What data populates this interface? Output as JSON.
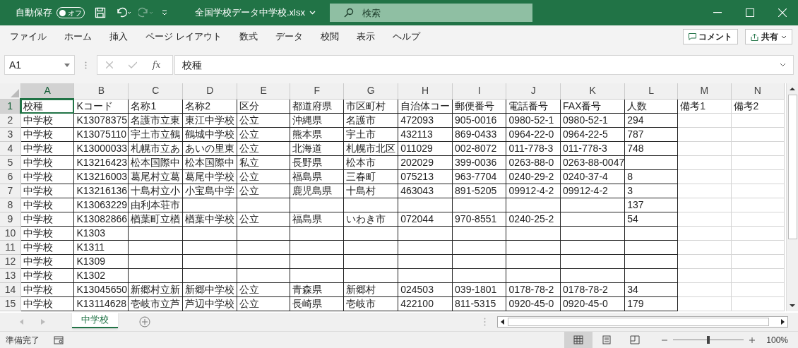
{
  "title_bar": {
    "autosave_label": "自動保存",
    "autosave_toggle": {
      "label": "オフ",
      "on": false
    },
    "file_name": "全国学校データ中学校.xlsx",
    "search_placeholder": "検索"
  },
  "ribbon_tabs": [
    "ファイル",
    "ホーム",
    "挿入",
    "ページ レイアウト",
    "数式",
    "データ",
    "校閲",
    "表示",
    "ヘルプ"
  ],
  "comment_button": "コメント",
  "share_button": "共有",
  "formula_bar": {
    "name_box": "A1",
    "fx": "fx",
    "formula": "校種"
  },
  "sheet": {
    "columns": [
      {
        "label": "A",
        "selected": true
      },
      {
        "label": "B",
        "selected": false
      },
      {
        "label": "C",
        "selected": false
      },
      {
        "label": "D",
        "selected": false
      },
      {
        "label": "E",
        "selected": false
      },
      {
        "label": "F",
        "selected": false
      },
      {
        "label": "G",
        "selected": false
      },
      {
        "label": "H",
        "selected": false
      },
      {
        "label": "I",
        "selected": false
      },
      {
        "label": "J",
        "selected": false
      },
      {
        "label": "K",
        "selected": false
      },
      {
        "label": "L",
        "selected": false
      },
      {
        "label": "M",
        "selected": false
      },
      {
        "label": "N",
        "selected": false
      }
    ],
    "rows": [
      {
        "number": "1",
        "selected": true,
        "cells": [
          "校種",
          "Kコード",
          "名称1",
          "名称2",
          "区分",
          "都道府県",
          "市区町村",
          "自治体コー",
          "郵便番号",
          "電話番号",
          "FAX番号",
          "人数",
          "備考1",
          "備考2"
        ]
      },
      {
        "number": "2",
        "selected": false,
        "cells": [
          "中学校",
          "K13078375",
          "名護市立東",
          "東江中学校",
          "公立",
          "沖縄県",
          "名護市",
          "472093",
          "905-0016",
          "0980-52-1",
          "0980-52-1",
          "294",
          null,
          null
        ]
      },
      {
        "number": "3",
        "selected": false,
        "cells": [
          "中学校",
          "K13075110",
          "宇土市立鶴",
          "鶴城中学校",
          "公立",
          "熊本県",
          "宇土市",
          "432113",
          "869-0433",
          "0964-22-0",
          "0964-22-5",
          "787",
          null,
          null
        ]
      },
      {
        "number": "4",
        "selected": false,
        "cells": [
          "中学校",
          "K13000033",
          "札幌市立あ",
          "あいの里東",
          "公立",
          "北海道",
          "札幌市北区",
          "011029",
          "002-8072",
          "011-778-3",
          "011-778-3",
          "748",
          null,
          null
        ]
      },
      {
        "number": "5",
        "selected": false,
        "cells": [
          "中学校",
          "K13216423",
          "松本国際中",
          "松本国際中",
          "私立",
          "長野県",
          "松本市",
          "202029",
          "399-0036",
          "0263-88-0",
          "0263-88-0047",
          null,
          null,
          null
        ]
      },
      {
        "number": "6",
        "selected": false,
        "cells": [
          "中学校",
          "K13216003",
          "葛尾村立葛",
          "葛尾中学校",
          "公立",
          "福島県",
          "三春町",
          "075213",
          "963-7704",
          "0240-29-2",
          "0240-37-4",
          "8",
          null,
          null
        ]
      },
      {
        "number": "7",
        "selected": false,
        "cells": [
          "中学校",
          "K13216136",
          "十島村立小",
          "小宝島中学",
          "公立",
          "鹿児島県",
          "十島村",
          "463043",
          "891-5205",
          "09912-4-2",
          "09912-4-2",
          "3",
          null,
          null
        ]
      },
      {
        "number": "8",
        "selected": false,
        "cells": [
          "中学校",
          "K13063229",
          "由利本荘市",
          null,
          null,
          null,
          null,
          null,
          null,
          null,
          null,
          "137",
          null,
          null
        ]
      },
      {
        "number": "9",
        "selected": false,
        "cells": [
          "中学校",
          "K13082866",
          "楢葉町立楢",
          "楢葉中学校",
          "公立",
          "福島県",
          "いわき市",
          "072044",
          "970-8551",
          "0240-25-2",
          null,
          "54",
          null,
          null
        ]
      },
      {
        "number": "10",
        "selected": false,
        "cells": [
          "中学校",
          "K1303",
          null,
          null,
          null,
          null,
          null,
          null,
          null,
          null,
          null,
          null,
          null,
          null
        ]
      },
      {
        "number": "11",
        "selected": false,
        "cells": [
          "中学校",
          "K1311",
          null,
          null,
          null,
          null,
          null,
          null,
          null,
          null,
          null,
          null,
          null,
          null
        ]
      },
      {
        "number": "12",
        "selected": false,
        "cells": [
          "中学校",
          "K1309",
          null,
          null,
          null,
          null,
          null,
          null,
          null,
          null,
          null,
          null,
          null,
          null
        ]
      },
      {
        "number": "13",
        "selected": false,
        "cells": [
          "中学校",
          "K1302",
          null,
          null,
          null,
          null,
          null,
          null,
          null,
          null,
          null,
          null,
          null,
          null
        ]
      },
      {
        "number": "14",
        "selected": false,
        "cells": [
          "中学校",
          "K13045650",
          "新郷村立新",
          "新郷中学校",
          "公立",
          "青森県",
          "新郷村",
          "024503",
          "039-1801",
          "0178-78-2",
          "0178-78-2",
          "34",
          null,
          null
        ]
      },
      {
        "number": "15",
        "selected": false,
        "cells": [
          "中学校",
          "K13114628",
          "壱岐市立芦",
          "芦辺中学校",
          "公立",
          "長崎県",
          "壱岐市",
          "422100",
          "811-5315",
          "0920-45-0",
          "0920-45-0",
          "179",
          null,
          null
        ]
      }
    ]
  },
  "sheet_tabs": [
    {
      "label": "中学校",
      "selected": true
    }
  ],
  "status_bar": {
    "status": "準備完了",
    "views": [
      {
        "kind": "normal",
        "selected": true
      },
      {
        "kind": "page_layout",
        "selected": false
      },
      {
        "kind": "page_break",
        "selected": false
      }
    ],
    "zoom": {
      "level": 0.5
    },
    "zoom_label": "100%"
  }
}
